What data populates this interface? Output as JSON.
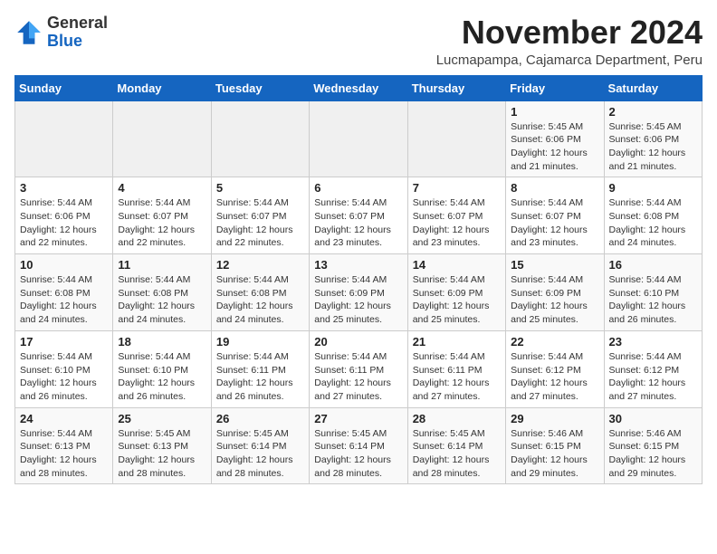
{
  "header": {
    "logo": {
      "line1": "General",
      "line2": "Blue"
    },
    "title": "November 2024",
    "location": "Lucmapampa, Cajamarca Department, Peru"
  },
  "weekdays": [
    "Sunday",
    "Monday",
    "Tuesday",
    "Wednesday",
    "Thursday",
    "Friday",
    "Saturday"
  ],
  "weeks": [
    [
      {
        "day": "",
        "info": ""
      },
      {
        "day": "",
        "info": ""
      },
      {
        "day": "",
        "info": ""
      },
      {
        "day": "",
        "info": ""
      },
      {
        "day": "",
        "info": ""
      },
      {
        "day": "1",
        "info": "Sunrise: 5:45 AM\nSunset: 6:06 PM\nDaylight: 12 hours and 21 minutes."
      },
      {
        "day": "2",
        "info": "Sunrise: 5:45 AM\nSunset: 6:06 PM\nDaylight: 12 hours and 21 minutes."
      }
    ],
    [
      {
        "day": "3",
        "info": "Sunrise: 5:44 AM\nSunset: 6:06 PM\nDaylight: 12 hours and 22 minutes."
      },
      {
        "day": "4",
        "info": "Sunrise: 5:44 AM\nSunset: 6:07 PM\nDaylight: 12 hours and 22 minutes."
      },
      {
        "day": "5",
        "info": "Sunrise: 5:44 AM\nSunset: 6:07 PM\nDaylight: 12 hours and 22 minutes."
      },
      {
        "day": "6",
        "info": "Sunrise: 5:44 AM\nSunset: 6:07 PM\nDaylight: 12 hours and 23 minutes."
      },
      {
        "day": "7",
        "info": "Sunrise: 5:44 AM\nSunset: 6:07 PM\nDaylight: 12 hours and 23 minutes."
      },
      {
        "day": "8",
        "info": "Sunrise: 5:44 AM\nSunset: 6:07 PM\nDaylight: 12 hours and 23 minutes."
      },
      {
        "day": "9",
        "info": "Sunrise: 5:44 AM\nSunset: 6:08 PM\nDaylight: 12 hours and 24 minutes."
      }
    ],
    [
      {
        "day": "10",
        "info": "Sunrise: 5:44 AM\nSunset: 6:08 PM\nDaylight: 12 hours and 24 minutes."
      },
      {
        "day": "11",
        "info": "Sunrise: 5:44 AM\nSunset: 6:08 PM\nDaylight: 12 hours and 24 minutes."
      },
      {
        "day": "12",
        "info": "Sunrise: 5:44 AM\nSunset: 6:08 PM\nDaylight: 12 hours and 24 minutes."
      },
      {
        "day": "13",
        "info": "Sunrise: 5:44 AM\nSunset: 6:09 PM\nDaylight: 12 hours and 25 minutes."
      },
      {
        "day": "14",
        "info": "Sunrise: 5:44 AM\nSunset: 6:09 PM\nDaylight: 12 hours and 25 minutes."
      },
      {
        "day": "15",
        "info": "Sunrise: 5:44 AM\nSunset: 6:09 PM\nDaylight: 12 hours and 25 minutes."
      },
      {
        "day": "16",
        "info": "Sunrise: 5:44 AM\nSunset: 6:10 PM\nDaylight: 12 hours and 26 minutes."
      }
    ],
    [
      {
        "day": "17",
        "info": "Sunrise: 5:44 AM\nSunset: 6:10 PM\nDaylight: 12 hours and 26 minutes."
      },
      {
        "day": "18",
        "info": "Sunrise: 5:44 AM\nSunset: 6:10 PM\nDaylight: 12 hours and 26 minutes."
      },
      {
        "day": "19",
        "info": "Sunrise: 5:44 AM\nSunset: 6:11 PM\nDaylight: 12 hours and 26 minutes."
      },
      {
        "day": "20",
        "info": "Sunrise: 5:44 AM\nSunset: 6:11 PM\nDaylight: 12 hours and 27 minutes."
      },
      {
        "day": "21",
        "info": "Sunrise: 5:44 AM\nSunset: 6:11 PM\nDaylight: 12 hours and 27 minutes."
      },
      {
        "day": "22",
        "info": "Sunrise: 5:44 AM\nSunset: 6:12 PM\nDaylight: 12 hours and 27 minutes."
      },
      {
        "day": "23",
        "info": "Sunrise: 5:44 AM\nSunset: 6:12 PM\nDaylight: 12 hours and 27 minutes."
      }
    ],
    [
      {
        "day": "24",
        "info": "Sunrise: 5:44 AM\nSunset: 6:13 PM\nDaylight: 12 hours and 28 minutes."
      },
      {
        "day": "25",
        "info": "Sunrise: 5:45 AM\nSunset: 6:13 PM\nDaylight: 12 hours and 28 minutes."
      },
      {
        "day": "26",
        "info": "Sunrise: 5:45 AM\nSunset: 6:14 PM\nDaylight: 12 hours and 28 minutes."
      },
      {
        "day": "27",
        "info": "Sunrise: 5:45 AM\nSunset: 6:14 PM\nDaylight: 12 hours and 28 minutes."
      },
      {
        "day": "28",
        "info": "Sunrise: 5:45 AM\nSunset: 6:14 PM\nDaylight: 12 hours and 28 minutes."
      },
      {
        "day": "29",
        "info": "Sunrise: 5:46 AM\nSunset: 6:15 PM\nDaylight: 12 hours and 29 minutes."
      },
      {
        "day": "30",
        "info": "Sunrise: 5:46 AM\nSunset: 6:15 PM\nDaylight: 12 hours and 29 minutes."
      }
    ]
  ]
}
